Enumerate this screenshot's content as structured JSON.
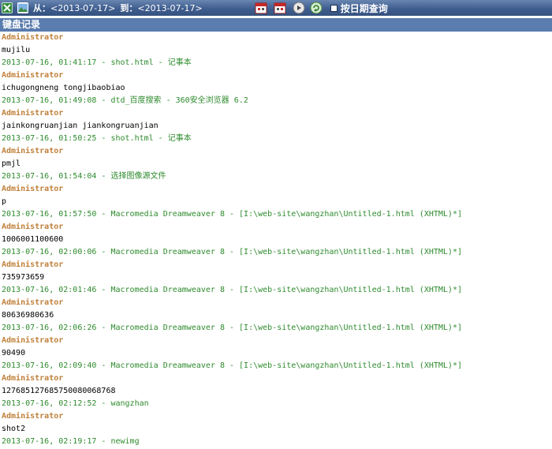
{
  "toolbar": {
    "from_label": "从：",
    "from_value": "<2013-07-17>",
    "to_label": "到：",
    "to_value": "<2013-07-17>",
    "date_query_label": "按日期查询",
    "icons": [
      "excel-export-icon",
      "image-icon",
      "calendar-icon",
      "calendar-alt-icon",
      "play-icon",
      "refresh-icon"
    ]
  },
  "header": {
    "title": "键盘记录"
  },
  "colors": {
    "toolbar_bg": "#3f5e8f",
    "header_bg": "#5a7cae",
    "user": "#c0803a",
    "meta": "#2e8b2e",
    "keys": "#000000"
  },
  "entries": [
    {
      "user": "Administrator",
      "keys": "mujilu",
      "meta": "2013-07-16, 01:41:17 - shot.html - 记事本"
    },
    {
      "user": "Administrator",
      "keys": "ichugongneng tongjibaobiao",
      "meta": "2013-07-16, 01:49:08 - dtd_百度搜索 - 360安全浏览器 6.2"
    },
    {
      "user": "Administrator",
      "keys": "jainkongruanjian jiankongruanjian",
      "meta": "2013-07-16, 01:50:25 - shot.html - 记事本"
    },
    {
      "user": "Administrator",
      "keys": "pmjl",
      "meta": "2013-07-16, 01:54:04 - 选择图像源文件"
    },
    {
      "user": "Administrator",
      "keys": "p",
      "meta": "2013-07-16, 01:57:50 - Macromedia Dreamweaver 8 - [I:\\web-site\\wangzhan\\Untitled-1.html (XHTML)*]"
    },
    {
      "user": "Administrator",
      "keys": "100600110060​0",
      "meta": "2013-07-16, 02:00:06 - Macromedia Dreamweaver 8 - [I:\\web-site\\wangzhan\\Untitled-1.html (XHTML)*]"
    },
    {
      "user": "Administrator",
      "keys": "735973659",
      "meta": "2013-07-16, 02:01:46 - Macromedia Dreamweaver 8 - [I:\\web-site\\wangzhan\\Untitled-1.html (XHTML)*]"
    },
    {
      "user": "Administrator",
      "keys": "80636980636",
      "meta": "2013-07-16, 02:06:26 - Macromedia Dreamweaver 8 - [I:\\web-site\\wangzhan\\Untitled-1.html (XHTML)*]"
    },
    {
      "user": "Administrator",
      "keys": "90490",
      "meta": "2013-07-16, 02:09:40 - Macromedia Dreamweaver 8 - [I:\\web-site\\wangzhan\\Untitled-1.html (XHTML)*]"
    },
    {
      "user": "Administrator",
      "keys": "127685127685750080068768",
      "meta": "2013-07-16, 02:12:52 - wangzhan"
    },
    {
      "user": "Administrator",
      "keys": "shot2",
      "meta": "2013-07-16, 02:19:17 - newimg"
    }
  ]
}
